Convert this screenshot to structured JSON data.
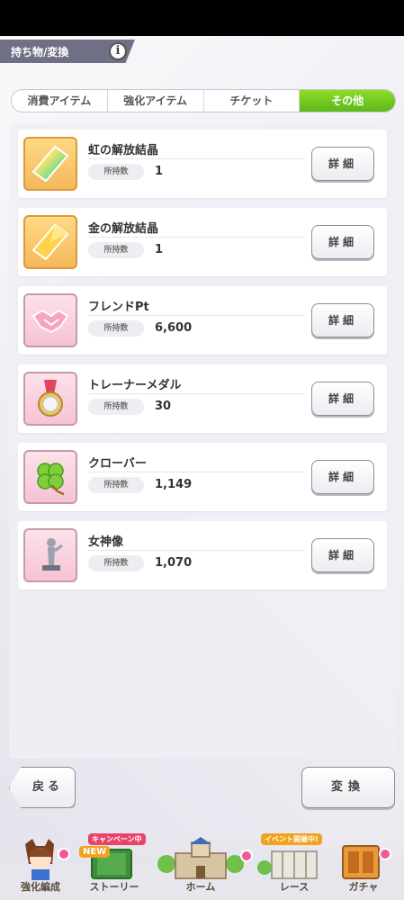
{
  "header": {
    "title": "持ち物/変換",
    "info_icon": "i"
  },
  "tabs": [
    {
      "label": "消費アイテム",
      "active": false
    },
    {
      "label": "強化アイテム",
      "active": false
    },
    {
      "label": "チケット",
      "active": false
    },
    {
      "label": "その他",
      "active": true
    }
  ],
  "colors": {
    "active_tab": "#6fc81f",
    "icon_gold": "#f4b85a",
    "icon_pink": "#f6c3d4",
    "badge_pink": "#f1579a"
  },
  "items": [
    {
      "name": "虹の解放結晶",
      "count_label": "所持数",
      "count": "1",
      "icon": "rainbow-crystal-icon",
      "detail_label": "詳細"
    },
    {
      "name": "金の解放結晶",
      "count_label": "所持数",
      "count": "1",
      "icon": "gold-crystal-icon",
      "detail_label": "詳細"
    },
    {
      "name": "フレンドPt",
      "count_label": "所持数",
      "count": "6,600",
      "icon": "handshake-icon",
      "detail_label": "詳細"
    },
    {
      "name": "トレーナーメダル",
      "count_label": "所持数",
      "count": "30",
      "icon": "medal-icon",
      "detail_label": "詳細"
    },
    {
      "name": "クローバー",
      "count_label": "所持数",
      "count": "1,149",
      "icon": "clover-icon",
      "detail_label": "詳細"
    },
    {
      "name": "女神像",
      "count_label": "所持数",
      "count": "1,070",
      "icon": "goddess-statue-icon",
      "detail_label": "詳細"
    }
  ],
  "footer": {
    "back_label": "戻る",
    "exchange_label": "変換"
  },
  "bottom_nav": [
    {
      "label": "強化編成",
      "icon": "character-icon"
    },
    {
      "label": "ストーリー",
      "icon": "book-icon",
      "badge": "キャンペーン中",
      "sub_badge": "NEW"
    },
    {
      "label": "ホーム",
      "icon": "school-building-icon"
    },
    {
      "label": "レース",
      "icon": "race-gate-icon",
      "badge": "イベント開催中!"
    },
    {
      "label": "ガチャ",
      "icon": "gacha-icon"
    }
  ]
}
